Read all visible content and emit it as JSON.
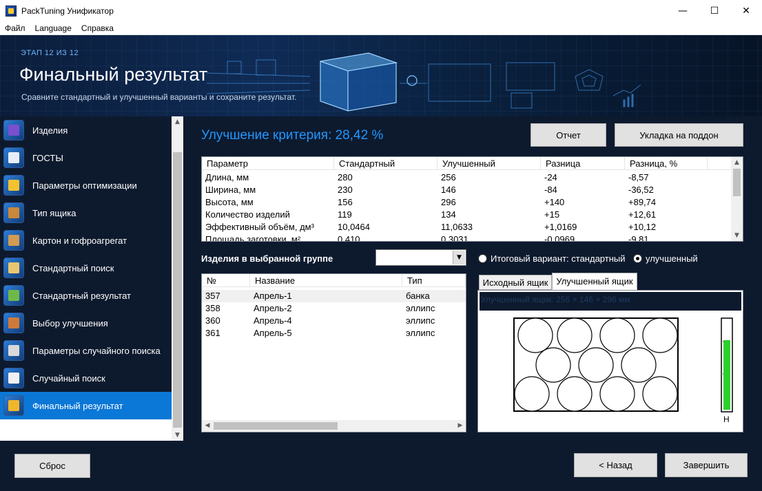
{
  "window": {
    "title": "PackTuning Унификатор",
    "minimize": "—",
    "maximize": "☐",
    "close": "✕"
  },
  "menu": [
    "Файл",
    "Language",
    "Справка"
  ],
  "banner": {
    "stage": "ЭТАП 12 ИЗ 12",
    "title": "Финальный результат",
    "subtitle": "Сравните стандартный и улучшенный варианты и сохраните результат."
  },
  "sidebar": {
    "items": [
      {
        "label": "Изделия",
        "icon": "bottles-icon",
        "color": "#7a4fd0"
      },
      {
        "label": "ГОСТЫ",
        "icon": "document-icon",
        "color": "#e8eef7"
      },
      {
        "label": "Параметры оптимизации",
        "icon": "checklist-icon",
        "color": "#f2c230"
      },
      {
        "label": "Тип ящика",
        "icon": "boxes-icon",
        "color": "#c9883a"
      },
      {
        "label": "Картон и гофроагрегат",
        "icon": "cardboard-icon",
        "color": "#d29b52"
      },
      {
        "label": "Стандартный поиск",
        "icon": "search-icon",
        "color": "#e9c770"
      },
      {
        "label": "Стандартный результат",
        "icon": "result-box-icon",
        "color": "#6fb84a"
      },
      {
        "label": "Выбор улучшения",
        "icon": "box-select-icon",
        "color": "#d07a3a"
      },
      {
        "label": "Параметры случайного поиска",
        "icon": "dice-settings-icon",
        "color": "#d9d9d9"
      },
      {
        "label": "Случайный поиск",
        "icon": "dice-icon",
        "color": "#f0f0f0"
      },
      {
        "label": "Финальный результат",
        "icon": "trophy-icon",
        "color": "#f2b62a"
      }
    ],
    "active_index": 10
  },
  "main": {
    "criterion": "Улучшение критерия: 28,42 %",
    "report_button": "Отчет",
    "pallet_button": "Укладка на поддон",
    "params_table": {
      "headers": [
        "Параметр",
        "Стандартный",
        "Улучшенный",
        "Разница",
        "Разница, %"
      ],
      "rows": [
        [
          "Длина, мм",
          "280",
          "256",
          "-24",
          "-8,57"
        ],
        [
          "Ширина, мм",
          "230",
          "146",
          "-84",
          "-36,52"
        ],
        [
          "Высота, мм",
          "156",
          "296",
          "+140",
          "+89,74"
        ],
        [
          "Количество изделий",
          "119",
          "134",
          "+15",
          "+12,61"
        ],
        [
          "Эффективный объём, дм³",
          "10,0464",
          "11,0633",
          "+1,0169",
          "+10,12"
        ],
        [
          "Площадь заготовки, м²",
          "0,410",
          "0,3031",
          "-0,0969",
          "-9,81"
        ]
      ]
    },
    "group_label": "Изделия в выбранной группе",
    "group_select_value": "",
    "items_table": {
      "headers": [
        "№",
        "Название",
        "Тип"
      ],
      "rows": [
        [
          "357",
          "Апрель-1",
          "банка"
        ],
        [
          "358",
          "Апрель-2",
          "эллипс"
        ],
        [
          "360",
          "Апрель-4",
          "эллипс"
        ],
        [
          "361",
          "Апрель-5",
          "эллипс"
        ]
      ],
      "selected_index": 0
    },
    "radio_standard": "Итоговый вариант: стандартный",
    "radio_improved": "улучшенный",
    "radio_selected": "improved",
    "tabs": [
      "Исходный ящик",
      "Улучшенный ящик"
    ],
    "active_tab": 1,
    "box_caption": "Улучшенный ящик: 256 × 146 × 296 мм",
    "height_label": "H",
    "fill_level": 0.78,
    "fill_color": "#2bd12b"
  },
  "footer": {
    "reset": "Сброс",
    "back": "< Назад",
    "finish": "Завершить"
  }
}
